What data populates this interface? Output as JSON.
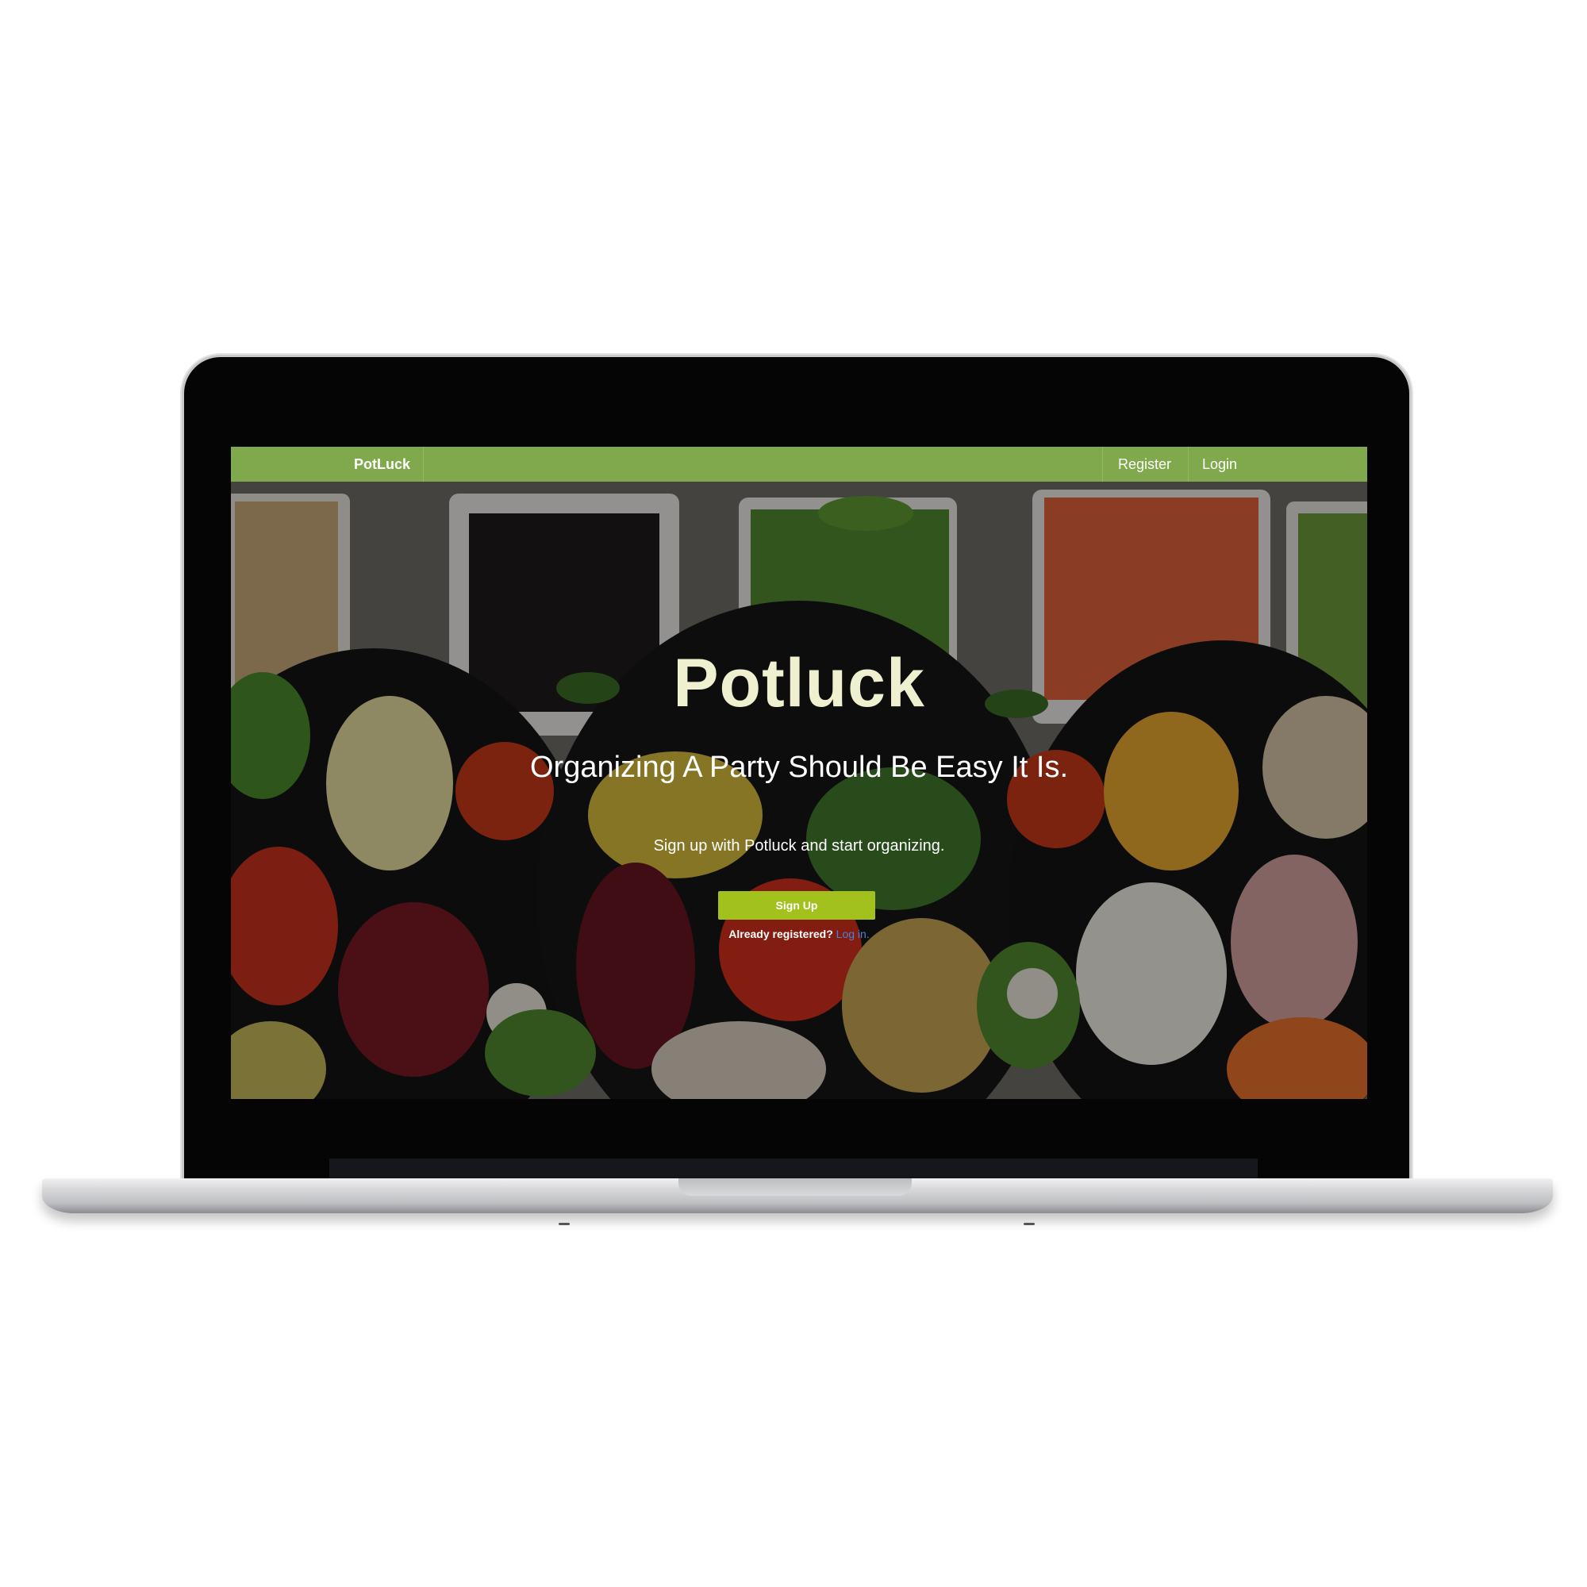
{
  "navbar": {
    "brand": "PotLuck",
    "links": [
      "Register",
      "Login"
    ],
    "color": "#80a94d"
  },
  "hero": {
    "title": "Potluck",
    "subtitle": "Organizing A Party Should Be Easy It Is.",
    "tagline": "Sign up with Potluck and start organizing.",
    "signup_label": "Sign Up",
    "already_text": "Already registered?",
    "login_link": "Log in.",
    "button_color": "#a2c11d",
    "title_color": "#eef0cf"
  }
}
